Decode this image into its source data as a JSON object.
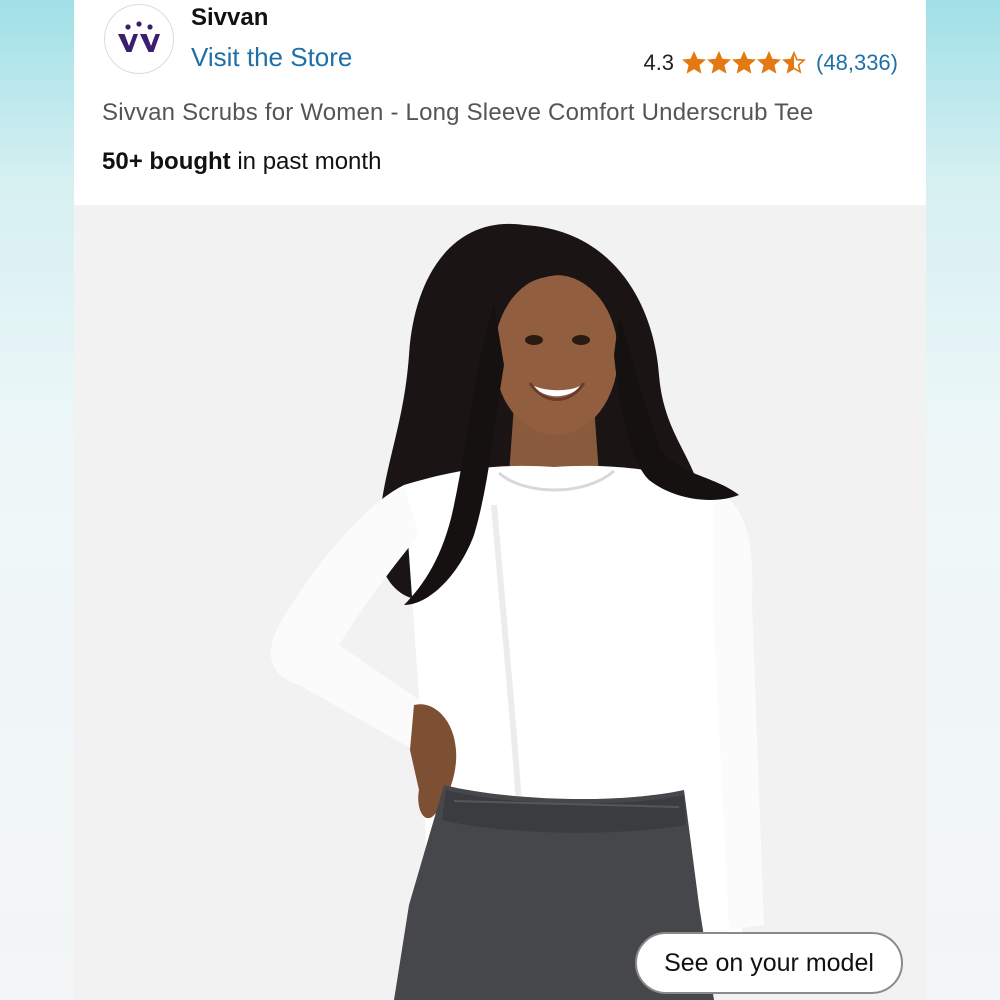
{
  "store": {
    "name": "Sivvan",
    "visit_link": "Visit the Store",
    "logo_icon": "sivvan-logo-icon"
  },
  "rating": {
    "value": "4.3",
    "stars_filled": 4.3,
    "stars_total": 5,
    "count": "(48,336)",
    "star_color": "#e47911"
  },
  "product": {
    "title": "Sivvan Scrubs for Women - Long Sleeve Comfort Underscrub Tee",
    "bought_bold": "50+ bought",
    "bought_rest": " in past month"
  },
  "image": {
    "description_icon": "product-photo-woman-white-long-sleeve-tee"
  },
  "actions": {
    "see_on_model": "See on your model"
  },
  "colors": {
    "link_blue": "#1f6fa8",
    "logo_purple": "#3b1f6e"
  }
}
